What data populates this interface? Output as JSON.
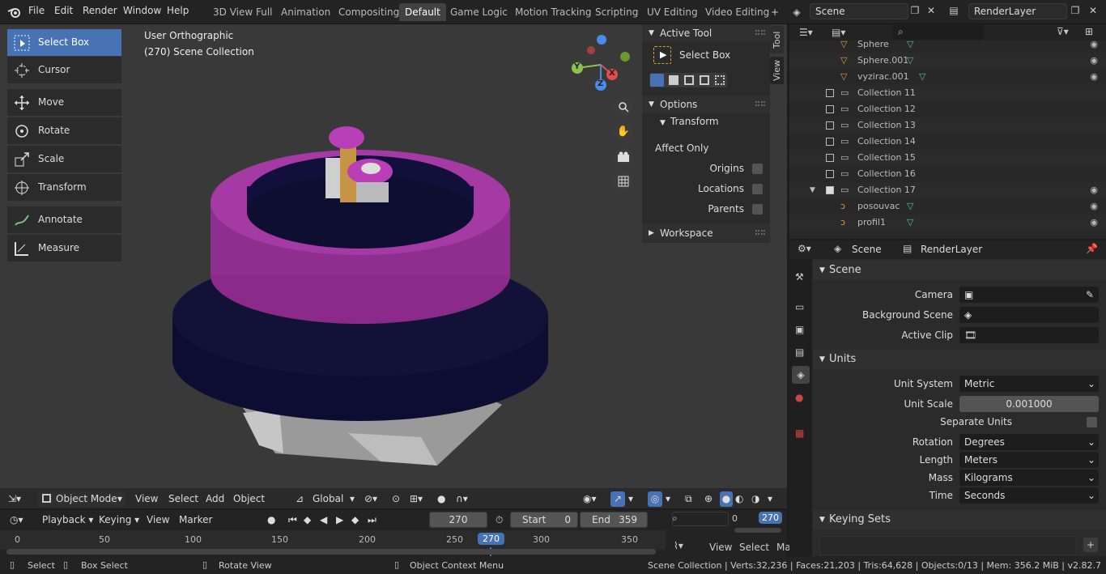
{
  "menu": [
    "File",
    "Edit",
    "Render",
    "Window",
    "Help"
  ],
  "workspaces": [
    {
      "label": "3D View Full"
    },
    {
      "label": "Animation"
    },
    {
      "label": "Compositing"
    },
    {
      "label": "Default",
      "active": true
    },
    {
      "label": "Game Logic"
    },
    {
      "label": "Motion Tracking"
    },
    {
      "label": "Scripting"
    },
    {
      "label": "UV Editing"
    },
    {
      "label": "Video Editing"
    }
  ],
  "scene_field": "Scene",
  "layer_field": "RenderLayer",
  "tools": [
    "Select Box",
    "Cursor",
    "Move",
    "Rotate",
    "Scale",
    "Transform",
    "Annotate",
    "Measure"
  ],
  "viewport": {
    "mode": "User Orthographic",
    "collection": "(270) Scene Collection"
  },
  "gizmo": {
    "x": "X",
    "y": "Y",
    "z": "Z"
  },
  "npanel": {
    "active_tool": "Active Tool",
    "tool_name": "Select Box",
    "options": "Options",
    "transform": "Transform",
    "affect_only": "Affect Only",
    "origins": "Origins",
    "locations": "Locations",
    "parents": "Parents",
    "workspace": "Workspace",
    "tab_tool": "Tool",
    "tab_view": "View"
  },
  "vp_header": {
    "mode": "Object Mode",
    "view": "View",
    "select": "Select",
    "add": "Add",
    "object": "Object",
    "orientation": "Global"
  },
  "timeline": {
    "playback": "Playback",
    "keying": "Keying",
    "view": "View",
    "marker": "Marker",
    "current": "270",
    "start_label": "Start",
    "start": "0",
    "end_label": "End",
    "end": "359",
    "ticks": [
      "0",
      "50",
      "100",
      "150",
      "200",
      "250",
      "270",
      "300",
      "350"
    ]
  },
  "graph_mini": {
    "zero": "0",
    "frame": "270",
    "view": "View",
    "select": "Select",
    "ma": "Ma"
  },
  "outliner": {
    "rows": [
      {
        "label": "Sphere",
        "type": "mesh"
      },
      {
        "label": "Sphere.001",
        "type": "mesh"
      },
      {
        "label": "vyzirac.001",
        "type": "mesh"
      },
      {
        "label": "Collection 11",
        "type": "collection"
      },
      {
        "label": "Collection 12",
        "type": "collection"
      },
      {
        "label": "Collection 13",
        "type": "collection"
      },
      {
        "label": "Collection 14",
        "type": "collection"
      },
      {
        "label": "Collection 15",
        "type": "collection"
      },
      {
        "label": "Collection 16",
        "type": "collection"
      },
      {
        "label": "Collection 17",
        "type": "collection"
      },
      {
        "label": "posouvac",
        "type": "curve"
      },
      {
        "label": "profil1",
        "type": "curve"
      }
    ]
  },
  "props": {
    "scene_tab": "Scene",
    "layer_tab": "RenderLayer",
    "scene_section": "Scene",
    "camera_label": "Camera",
    "bg_label": "Background Scene",
    "clip_label": "Active Clip",
    "units_section": "Units",
    "unit_system_label": "Unit System",
    "unit_system": "Metric",
    "unit_scale_label": "Unit Scale",
    "unit_scale": "0.001000",
    "separate_units": "Separate Units",
    "rotation_label": "Rotation",
    "rotation": "Degrees",
    "length_label": "Length",
    "length": "Meters",
    "mass_label": "Mass",
    "mass": "Kilograms",
    "time_label": "Time",
    "time": "Seconds",
    "keying_section": "Keying Sets"
  },
  "status": {
    "select": "Select",
    "box_select": "Box Select",
    "rotate_view": "Rotate View",
    "context_menu": "Object Context Menu",
    "stats": "Scene Collection | Verts:32,236 | Faces:21,203 | Tris:64,628 | Objects:0/13 | Mem: 356.2 MiB | v2.82.7"
  }
}
